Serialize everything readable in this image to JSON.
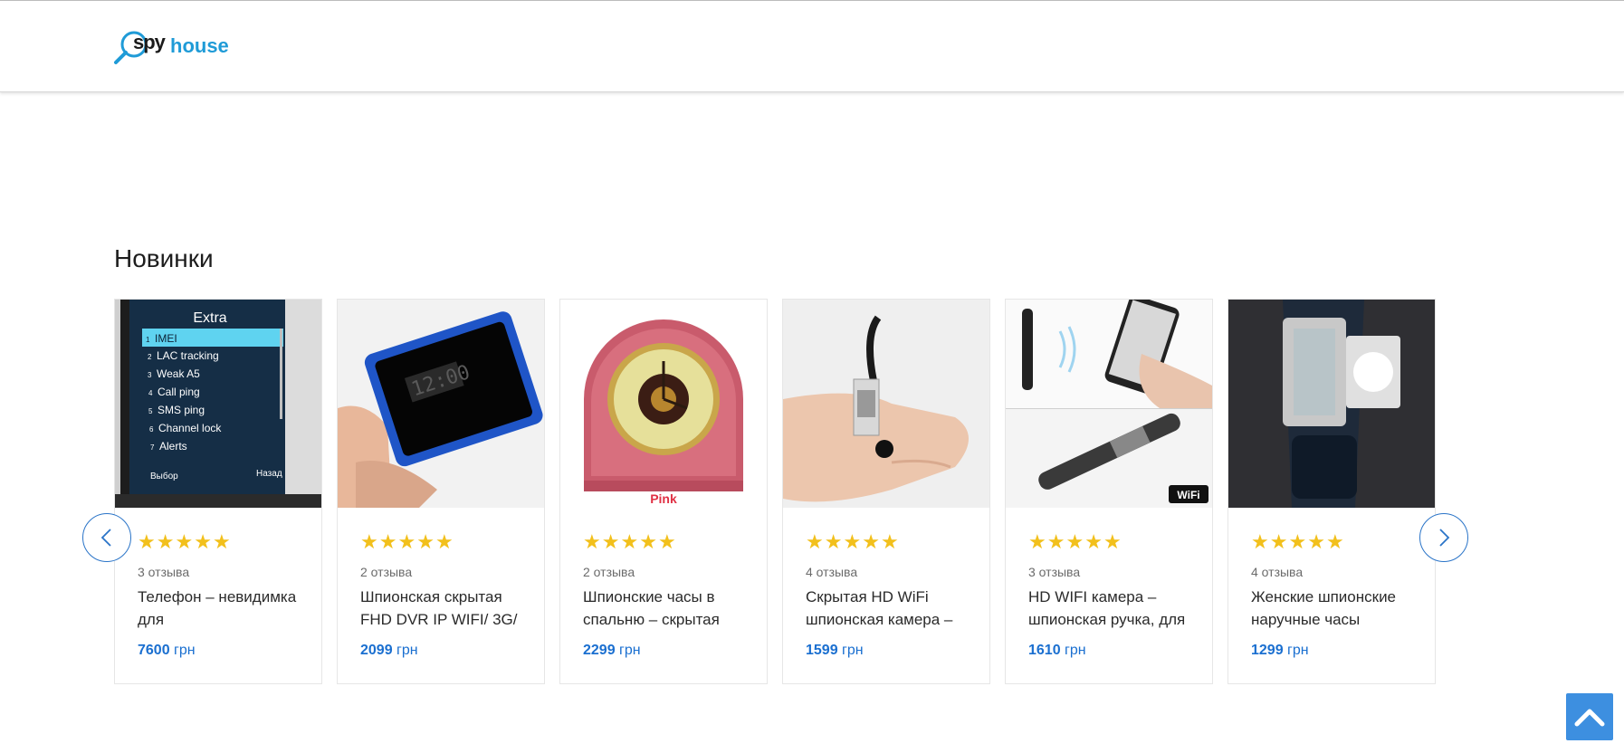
{
  "header": {
    "logo": {
      "word1": "spy",
      "word2": "house"
    }
  },
  "section": {
    "title": "Новинки"
  },
  "currency": "грн",
  "products": [
    {
      "title": "Телефон – невидимка для",
      "reviews": "3 отзыва",
      "price": "7600",
      "currency": "грн",
      "rating": 5,
      "image_texts": [
        "Extra",
        "IMEI",
        "LAC tracking",
        "Weak A5",
        "Call ping",
        "SMS ping",
        "Channel lock",
        "Alerts",
        "Выбор",
        "Назад"
      ]
    },
    {
      "title": "Шпионская скрытая FHD DVR IP WIFI/ 3G/",
      "reviews": "2 отзыва",
      "price": "2099",
      "currency": "грн",
      "rating": 5,
      "image_texts": [
        "12:00"
      ]
    },
    {
      "title": "Шпионские часы в спальню – скрытая",
      "reviews": "2 отзыва",
      "price": "2299",
      "currency": "грн",
      "rating": 5,
      "image_texts": [
        "Pink"
      ]
    },
    {
      "title": "Скрытая HD WiFi шпионская камера –",
      "reviews": "4 отзыва",
      "price": "1599",
      "currency": "грн",
      "rating": 5,
      "image_texts": []
    },
    {
      "title": "HD WIFI камера – шпионская ручка, для",
      "reviews": "3 отзыва",
      "price": "1610",
      "currency": "грн",
      "rating": 5,
      "image_texts": [
        "WiFi"
      ]
    },
    {
      "title": "Женские шпионские наручные часы",
      "reviews": "4 отзыва",
      "price": "1299",
      "currency": "грн",
      "rating": 5,
      "image_texts": []
    }
  ],
  "colors": {
    "accent": "#1a6fd0",
    "brand_blue": "#1f9bd7",
    "star": "#f2c01c",
    "scroll_button": "#3d8fe0"
  },
  "icons": {
    "logo": "magnifier-icon",
    "prev": "chevron-left-icon",
    "next": "chevron-right-icon",
    "scroll_top": "chevron-up-icon",
    "star": "star-icon"
  }
}
